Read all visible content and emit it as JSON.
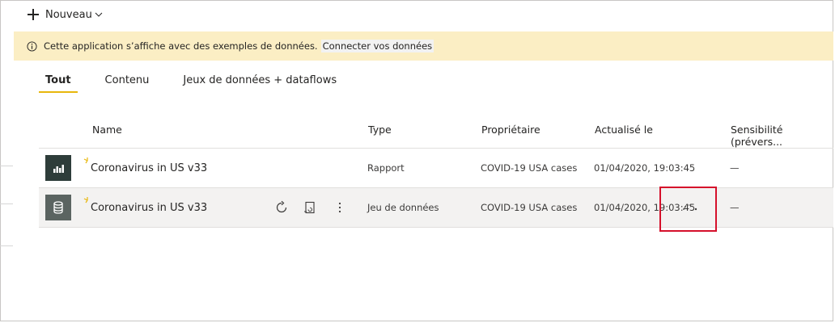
{
  "toolbar": {
    "new_label": "Nouveau",
    "new_icon": "plus-icon",
    "chevron_icon": "chevron-down-icon"
  },
  "banner": {
    "icon": "info-icon",
    "message": "Cette application s’affiche avec des exemples de données.",
    "link": "Connecter vos données",
    "background": "#fbeec4"
  },
  "tabs": [
    {
      "label": "Tout",
      "active": true
    },
    {
      "label": "Contenu",
      "active": false
    },
    {
      "label": "Jeux de données + dataflows",
      "active": false
    }
  ],
  "table": {
    "columns": [
      "Name",
      "Type",
      "Propriétaire",
      "Actualisé le",
      "Sensibilité (prévers..."
    ],
    "rows": [
      {
        "icon": "report-icon",
        "name": "Coronavirus in US v33",
        "type": "Rapport",
        "owner": "COVID-19 USA cases",
        "refreshed": "01/04/2020, 19:03:45",
        "sensitivity": "—"
      },
      {
        "icon": "dataset-icon",
        "name": "Coronavirus in US v33",
        "type": "Jeu de données",
        "owner": "COVID-19 USA cases",
        "refreshed": "01/04/2020, 19:03:45",
        "sensitivity": "—",
        "actions": [
          "refresh-icon",
          "schedule-refresh-icon",
          "more-options-icon"
        ],
        "refreshing": true
      }
    ]
  },
  "colors": {
    "accent_underline": "#e8b70c",
    "highlight_box": "#d5102b",
    "report_icon_bg": "#2e3d3a",
    "dataset_icon_bg": "#5b6461"
  }
}
